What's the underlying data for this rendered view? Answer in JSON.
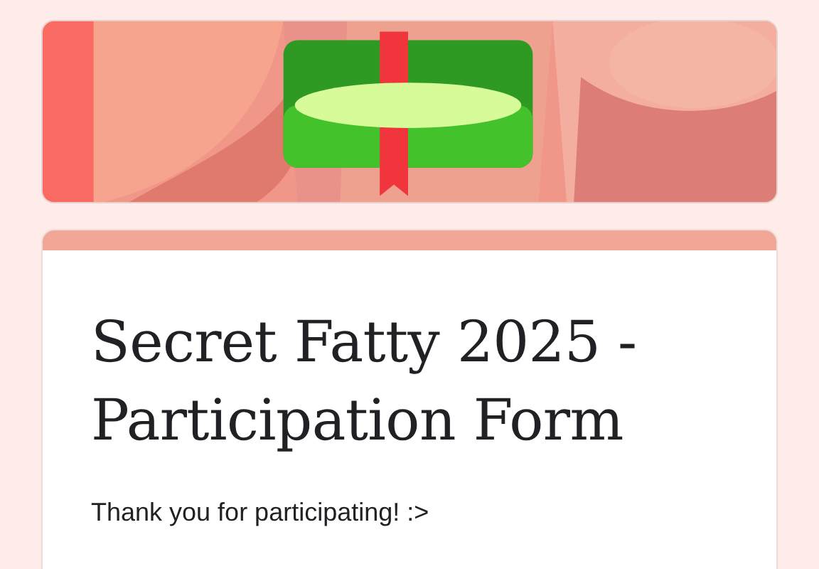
{
  "form": {
    "title": "Secret Fatty 2025 - Participation Form",
    "description": "Thank you for participating! :>"
  }
}
